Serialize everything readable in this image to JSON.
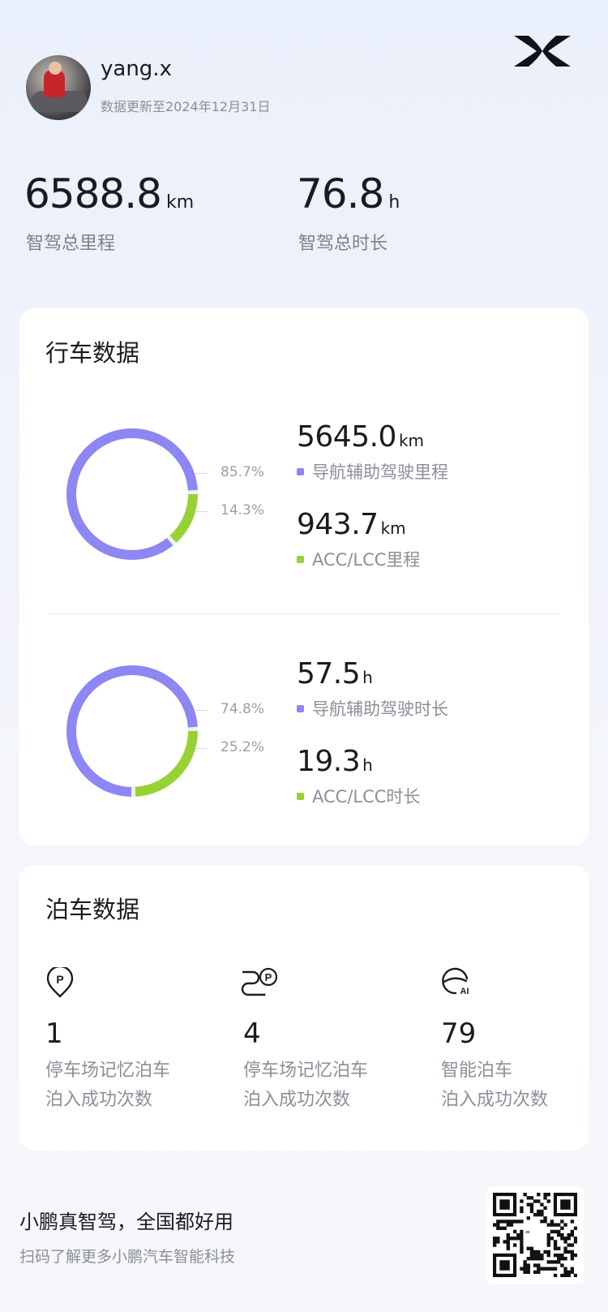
{
  "header": {
    "username": "yang.x",
    "update_text": "数据更新至2024年12月31日",
    "logo_icon": "xpeng-x-logo"
  },
  "summary": {
    "distance": {
      "value": "6588.8",
      "unit": "km",
      "label": "智驾总里程"
    },
    "duration": {
      "value": "76.8",
      "unit": "h",
      "label": "智驾总时长"
    }
  },
  "driving": {
    "title": "行车数据",
    "colors": {
      "primary": "#8c87f2",
      "secondary": "#97d235"
    },
    "mileage": {
      "share": [
        85.7,
        14.3
      ],
      "pct_labels": [
        "85.7%",
        "14.3%"
      ],
      "items": [
        {
          "value": "5645.0",
          "unit": "km",
          "label": "导航辅助驾驶里程"
        },
        {
          "value": "943.7",
          "unit": "km",
          "label": "ACC/LCC里程"
        }
      ]
    },
    "time": {
      "share": [
        74.8,
        25.2
      ],
      "pct_labels": [
        "74.8%",
        "25.2%"
      ],
      "items": [
        {
          "value": "57.5",
          "unit": "h",
          "label": "导航辅助驾驶时长"
        },
        {
          "value": "19.3",
          "unit": "h",
          "label": "ACC/LCC时长"
        }
      ]
    }
  },
  "parking": {
    "title": "泊车数据",
    "items": [
      {
        "icon": "parking-location-icon",
        "value": "1",
        "label1": "停车场记忆泊车",
        "label2": "泊入成功次数"
      },
      {
        "icon": "parking-route-icon",
        "value": "4",
        "label1": "停车场记忆泊车",
        "label2": "泊入成功次数"
      },
      {
        "icon": "ai-steering-icon",
        "value": "79",
        "label1": "智能泊车",
        "label2": "泊入成功次数"
      }
    ]
  },
  "footer": {
    "slogan": "小鹏真智驾，全国都好用",
    "sub": "扫码了解更多小鹏汽车智能科技",
    "qr_icon": "qr-code-icon"
  }
}
